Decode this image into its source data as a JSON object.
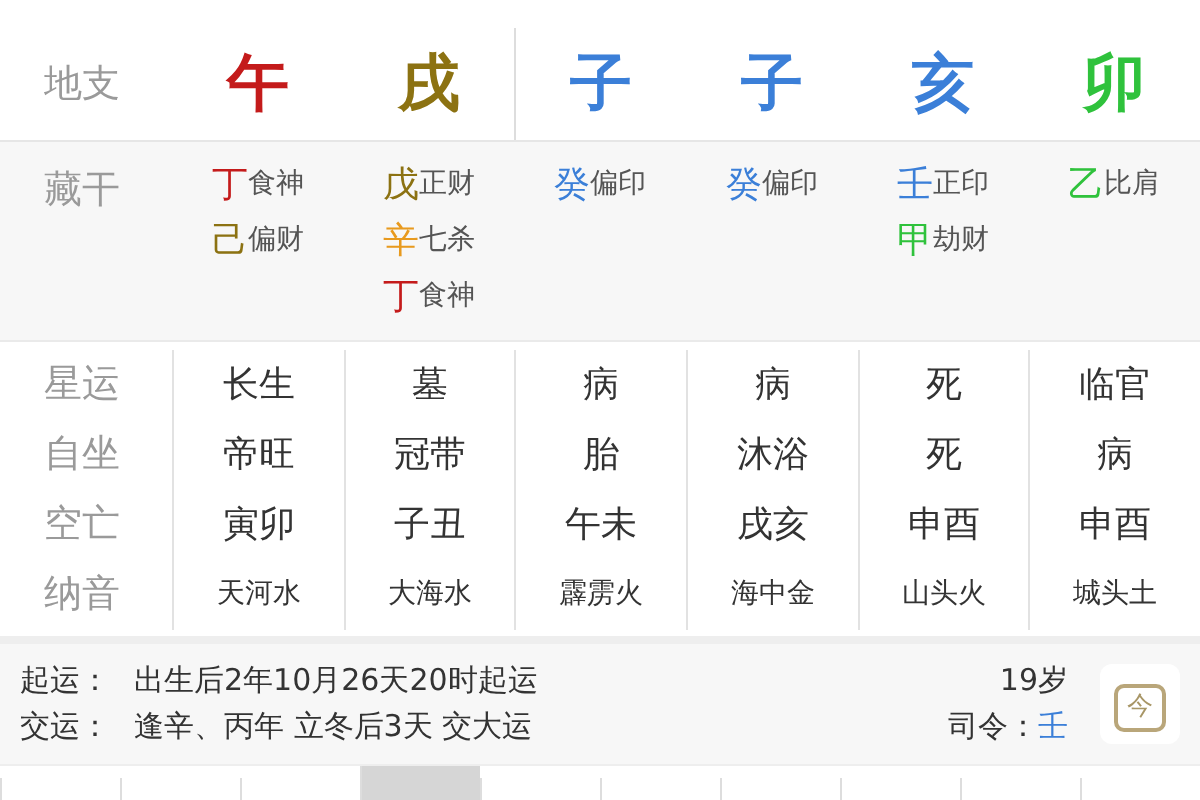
{
  "branches": {
    "label": "地支",
    "items": [
      {
        "text": "午",
        "color": "#c41b1b"
      },
      {
        "text": "戌",
        "color": "#8c7212"
      },
      {
        "text": "子",
        "color": "#3b7fd8"
      },
      {
        "text": "子",
        "color": "#3b7fd8"
      },
      {
        "text": "亥",
        "color": "#3b7fd8"
      },
      {
        "text": "卯",
        "color": "#2fc23c"
      }
    ]
  },
  "hidden_stems": {
    "label": "藏干",
    "columns": [
      [
        {
          "stem": "丁",
          "color": "#c41b1b",
          "god": "食神"
        },
        {
          "stem": "己",
          "color": "#8c7212",
          "god": "偏财"
        }
      ],
      [
        {
          "stem": "戊",
          "color": "#8c7212",
          "god": "正财"
        },
        {
          "stem": "辛",
          "color": "#e89a1e",
          "god": "七杀"
        },
        {
          "stem": "丁",
          "color": "#c41b1b",
          "god": "食神"
        }
      ],
      [
        {
          "stem": "癸",
          "color": "#3b7fd8",
          "god": "偏印"
        }
      ],
      [
        {
          "stem": "癸",
          "color": "#3b7fd8",
          "god": "偏印"
        }
      ],
      [
        {
          "stem": "壬",
          "color": "#3b7fd8",
          "god": "正印"
        },
        {
          "stem": "甲",
          "color": "#2fc23c",
          "god": "劫财"
        }
      ],
      [
        {
          "stem": "乙",
          "color": "#2fc23c",
          "god": "比肩"
        }
      ]
    ]
  },
  "info_rows": [
    {
      "kind": "normal",
      "label": "星运",
      "cells": [
        "长生",
        "墓",
        "病",
        "病",
        "死",
        "临官"
      ]
    },
    {
      "kind": "normal",
      "label": "自坐",
      "cells": [
        "帝旺",
        "冠带",
        "胎",
        "沐浴",
        "死",
        "病"
      ]
    },
    {
      "kind": "normal",
      "label": "空亡",
      "cells": [
        "寅卯",
        "子丑",
        "午未",
        "戌亥",
        "申酉",
        "申酉"
      ]
    },
    {
      "kind": "small",
      "label": "纳音",
      "cells": [
        "天河水",
        "大海水",
        "霹雳火",
        "海中金",
        "山头火",
        "城头土"
      ]
    }
  ],
  "luck": {
    "rows": [
      {
        "label": "起运：",
        "value": "出生后2年10月26天20时起运"
      },
      {
        "label": "交运：",
        "value": "逢辛、丙年 立冬后3天 交大运"
      }
    ],
    "age": "19岁",
    "commander_label": "司令：",
    "commander": {
      "text": "壬",
      "color": "#3b7fd8"
    },
    "today_button": "今"
  },
  "bottom_tabs": [
    {
      "selected": false
    },
    {
      "selected": false
    },
    {
      "selected": false
    },
    {
      "selected": true
    },
    {
      "selected": false
    },
    {
      "selected": false
    },
    {
      "selected": false
    },
    {
      "selected": false
    },
    {
      "selected": false
    },
    {
      "selected": false
    }
  ]
}
